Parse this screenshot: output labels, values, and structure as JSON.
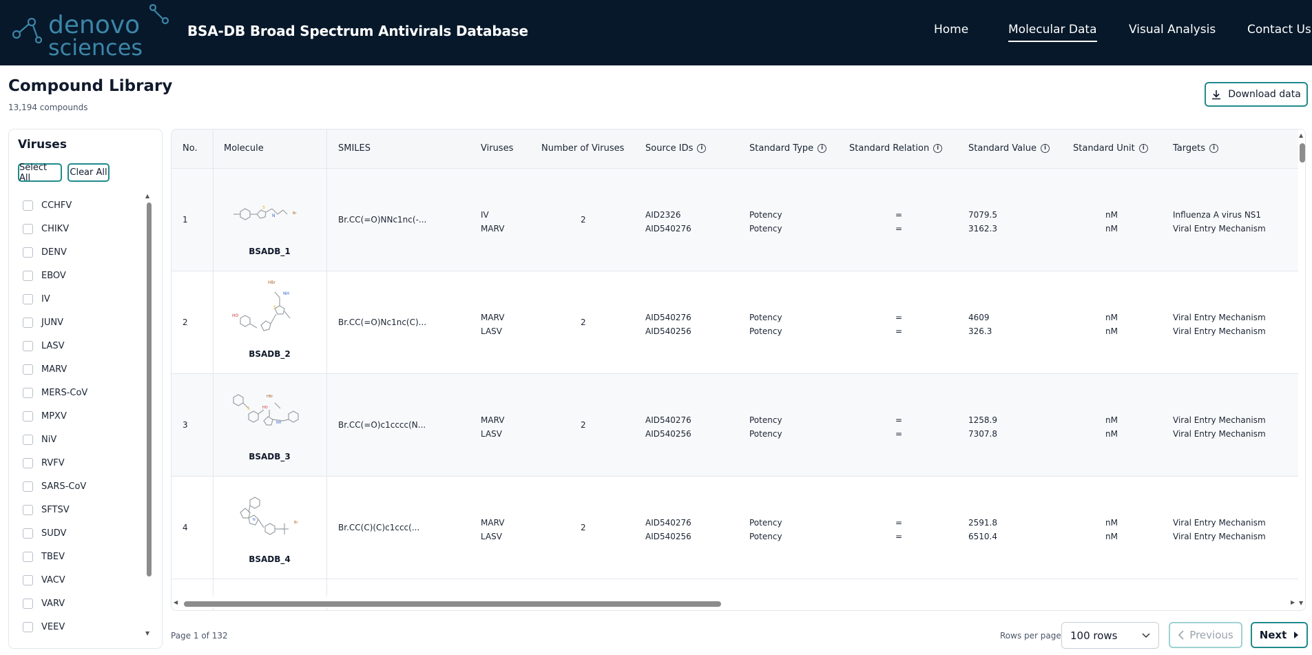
{
  "header": {
    "logo_text_line1": "denovo",
    "logo_text_line2": "sciences",
    "app_title": "BSA-DB Broad Spectrum Antivirals Database",
    "nav": [
      {
        "label": "Home",
        "active": false
      },
      {
        "label": "Molecular Data",
        "active": true
      },
      {
        "label": "Visual Analysis",
        "active": false
      },
      {
        "label": "Contact Us",
        "active": false
      }
    ]
  },
  "page": {
    "title": "Compound Library",
    "subtitle": "13,194 compounds",
    "download_label": "Download data"
  },
  "sidebar": {
    "title": "Viruses",
    "select_all": "Select All",
    "clear_all": "Clear All",
    "viruses": [
      "CCHFV",
      "CHIKV",
      "DENV",
      "EBOV",
      "IV",
      "JUNV",
      "LASV",
      "MARV",
      "MERS-CoV",
      "MPXV",
      "NiV",
      "RVFV",
      "SARS-CoV",
      "SFTSV",
      "SUDV",
      "TBEV",
      "VACV",
      "VARV",
      "VEEV"
    ]
  },
  "table": {
    "columns": [
      "No.",
      "Molecule",
      "SMILES",
      "Viruses",
      "Number of Viruses",
      "Source IDs",
      "Standard Type",
      "Standard Relation",
      "Standard Value",
      "Standard Unit",
      "Targets"
    ],
    "rows": [
      {
        "no": "1",
        "molecule": "BSADB_1",
        "smiles": "Br.CC(=O)NNc1nc(-...",
        "viruses": [
          "IV",
          "MARV"
        ],
        "num_viruses": "2",
        "source_ids": [
          "AID2326",
          "AID540276"
        ],
        "standard_type": [
          "Potency",
          "Potency"
        ],
        "standard_relation": [
          "=",
          "="
        ],
        "standard_value": [
          "7079.5",
          "3162.3"
        ],
        "standard_unit": [
          "nM",
          "nM"
        ],
        "targets": [
          "Influenza A virus NS1",
          "Viral Entry Mechanism"
        ]
      },
      {
        "no": "2",
        "molecule": "BSADB_2",
        "smiles": "Br.CC(=O)Nc1nc(C)...",
        "viruses": [
          "MARV",
          "LASV"
        ],
        "num_viruses": "2",
        "source_ids": [
          "AID540276",
          "AID540256"
        ],
        "standard_type": [
          "Potency",
          "Potency"
        ],
        "standard_relation": [
          "=",
          "="
        ],
        "standard_value": [
          "4609",
          "326.3"
        ],
        "standard_unit": [
          "nM",
          "nM"
        ],
        "targets": [
          "Viral Entry Mechanism",
          "Viral Entry Mechanism"
        ]
      },
      {
        "no": "3",
        "molecule": "BSADB_3",
        "smiles": "Br.CC(=O)c1cccc(N...",
        "viruses": [
          "MARV",
          "LASV"
        ],
        "num_viruses": "2",
        "source_ids": [
          "AID540276",
          "AID540256"
        ],
        "standard_type": [
          "Potency",
          "Potency"
        ],
        "standard_relation": [
          "=",
          "="
        ],
        "standard_value": [
          "1258.9",
          "7307.8"
        ],
        "standard_unit": [
          "nM",
          "nM"
        ],
        "targets": [
          "Viral Entry Mechanism",
          "Viral Entry Mechanism"
        ]
      },
      {
        "no": "4",
        "molecule": "BSADB_4",
        "smiles": "Br.CC(C)(C)c1ccc(...",
        "viruses": [
          "MARV",
          "LASV"
        ],
        "num_viruses": "2",
        "source_ids": [
          "AID540276",
          "AID540256"
        ],
        "standard_type": [
          "Potency",
          "Potency"
        ],
        "standard_relation": [
          "=",
          "="
        ],
        "standard_value": [
          "2591.8",
          "6510.4"
        ],
        "standard_unit": [
          "nM",
          "nM"
        ],
        "targets": [
          "Viral Entry Mechanism",
          "Viral Entry Mechanism"
        ]
      }
    ]
  },
  "footer": {
    "page_info": "Page 1 of 132",
    "rows_per_page_label": "Rows per page",
    "rows_per_page_value": "100 rows",
    "previous_label": "Previous",
    "next_label": "Next"
  },
  "colors": {
    "header_bg": "#06182a",
    "accent": "#1f8a8c",
    "logo": "#3c86a8"
  }
}
